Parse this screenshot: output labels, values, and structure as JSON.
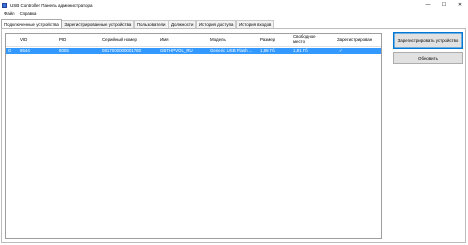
{
  "window": {
    "title": "USB Controller Панель администратора",
    "minimize": "—",
    "maximize": "☐",
    "close": "✕"
  },
  "menu": [
    "Файл",
    "Справка"
  ],
  "tabs": [
    {
      "label": "Подключенные устройства",
      "active": true
    },
    {
      "label": "Зарегистрированные устройства",
      "active": false
    },
    {
      "label": "Пользователи",
      "active": false
    },
    {
      "label": "Должности",
      "active": false
    },
    {
      "label": "История доступа",
      "active": false
    },
    {
      "label": "История входов",
      "active": false
    }
  ],
  "table": {
    "columns": [
      "VID",
      "PID",
      "Серийный номер",
      "Имя",
      "Модель",
      "Размер",
      "Свободное место",
      "Зарегистрирован"
    ],
    "rows": [
      {
        "marker": "G",
        "vid": "8644",
        "pid": "8005",
        "serial": "0817000000001780",
        "name": "GBTHPVOL_RU",
        "model": "Generic USB Flash ...",
        "size": "1,88 Гб",
        "free": "1,81 Гб",
        "registered": "✓"
      }
    ]
  },
  "buttons": {
    "register": "Зарегистрировать устройство",
    "refresh": "Обновить"
  },
  "colors": {
    "selection": "#3399ff",
    "window_bg": "#ffffff",
    "button_bg": "#e1e1e1",
    "focus_border": "#0078d7"
  }
}
